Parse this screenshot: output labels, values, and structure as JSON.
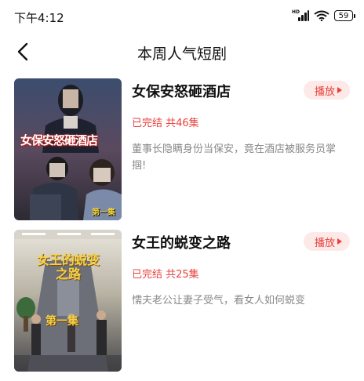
{
  "status_bar": {
    "time": "下午4:12",
    "network_label": "HD",
    "battery": "59"
  },
  "nav": {
    "title": "本周人气短剧"
  },
  "dramas": [
    {
      "title": "女保安怒砸酒店",
      "status": "已完结 共46集",
      "description": "董事长隐瞒身份当保安，竟在酒店被服务员掌掴!",
      "play_label": "播放",
      "poster_title": "女保安怒砸酒店",
      "poster_episode": "第一集"
    },
    {
      "title": "女王的蜕变之路",
      "status": "已完结 共25集",
      "description": "懦夫老公让妻子受气，看女人如何蜕变",
      "play_label": "播放",
      "poster_title": "女王的蜕变之路",
      "poster_episode": "第一集"
    }
  ],
  "colors": {
    "accent": "#e7423d",
    "play_bg": "#fde9e8",
    "desc_text": "#888888"
  }
}
